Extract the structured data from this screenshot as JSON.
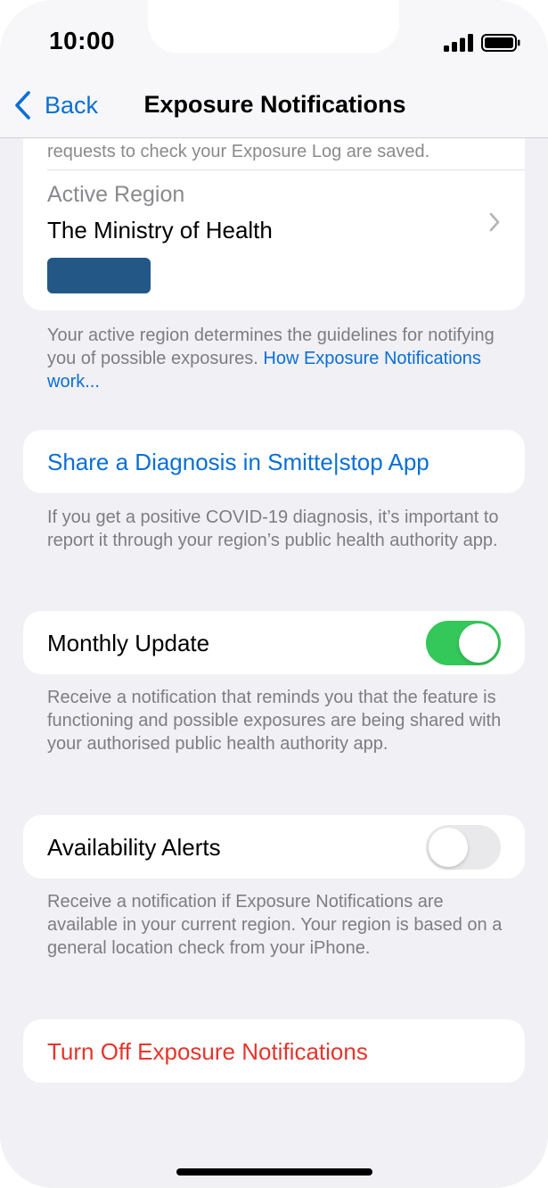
{
  "status_bar": {
    "time": "10:00",
    "signal_icon": "cellular-signal-icon",
    "battery_icon": "battery-icon"
  },
  "nav": {
    "back_label": "Back",
    "back_icon": "chevron-left-icon",
    "title": "Exposure Notifications"
  },
  "region_card": {
    "truncated_text": "requests to check your Exposure Log are saved.",
    "label": "Active Region",
    "name": "The Ministry of Health",
    "chevron_icon": "chevron-right-icon",
    "badge_color": "#225786"
  },
  "region_footer": {
    "text": "Your active region determines the guidelines for notifying you of possible exposures.",
    "link": "How Exposure Notifications work..."
  },
  "share": {
    "label": "Share a Diagnosis in Smitte|stop App",
    "footer": "If you get a positive COVID-19 diagnosis, it’s important to report it through your region’s public health authority app."
  },
  "monthly_update": {
    "label": "Monthly Update",
    "enabled": true,
    "footer": "Receive a notification that reminds you that the feature is functioning and possible exposures are being shared with your authorised public health authority app."
  },
  "availability_alerts": {
    "label": "Availability Alerts",
    "enabled": false,
    "footer": "Receive a notification if Exposure Notifications are available in your current region. Your region is based on a general location check from your iPhone."
  },
  "turn_off": {
    "label": "Turn Off Exposure Notifications"
  },
  "colors": {
    "accent": "#0a6fd6",
    "destructive": "#e5352b",
    "toggle_on": "#34c759",
    "background": "#f0f0f5"
  }
}
